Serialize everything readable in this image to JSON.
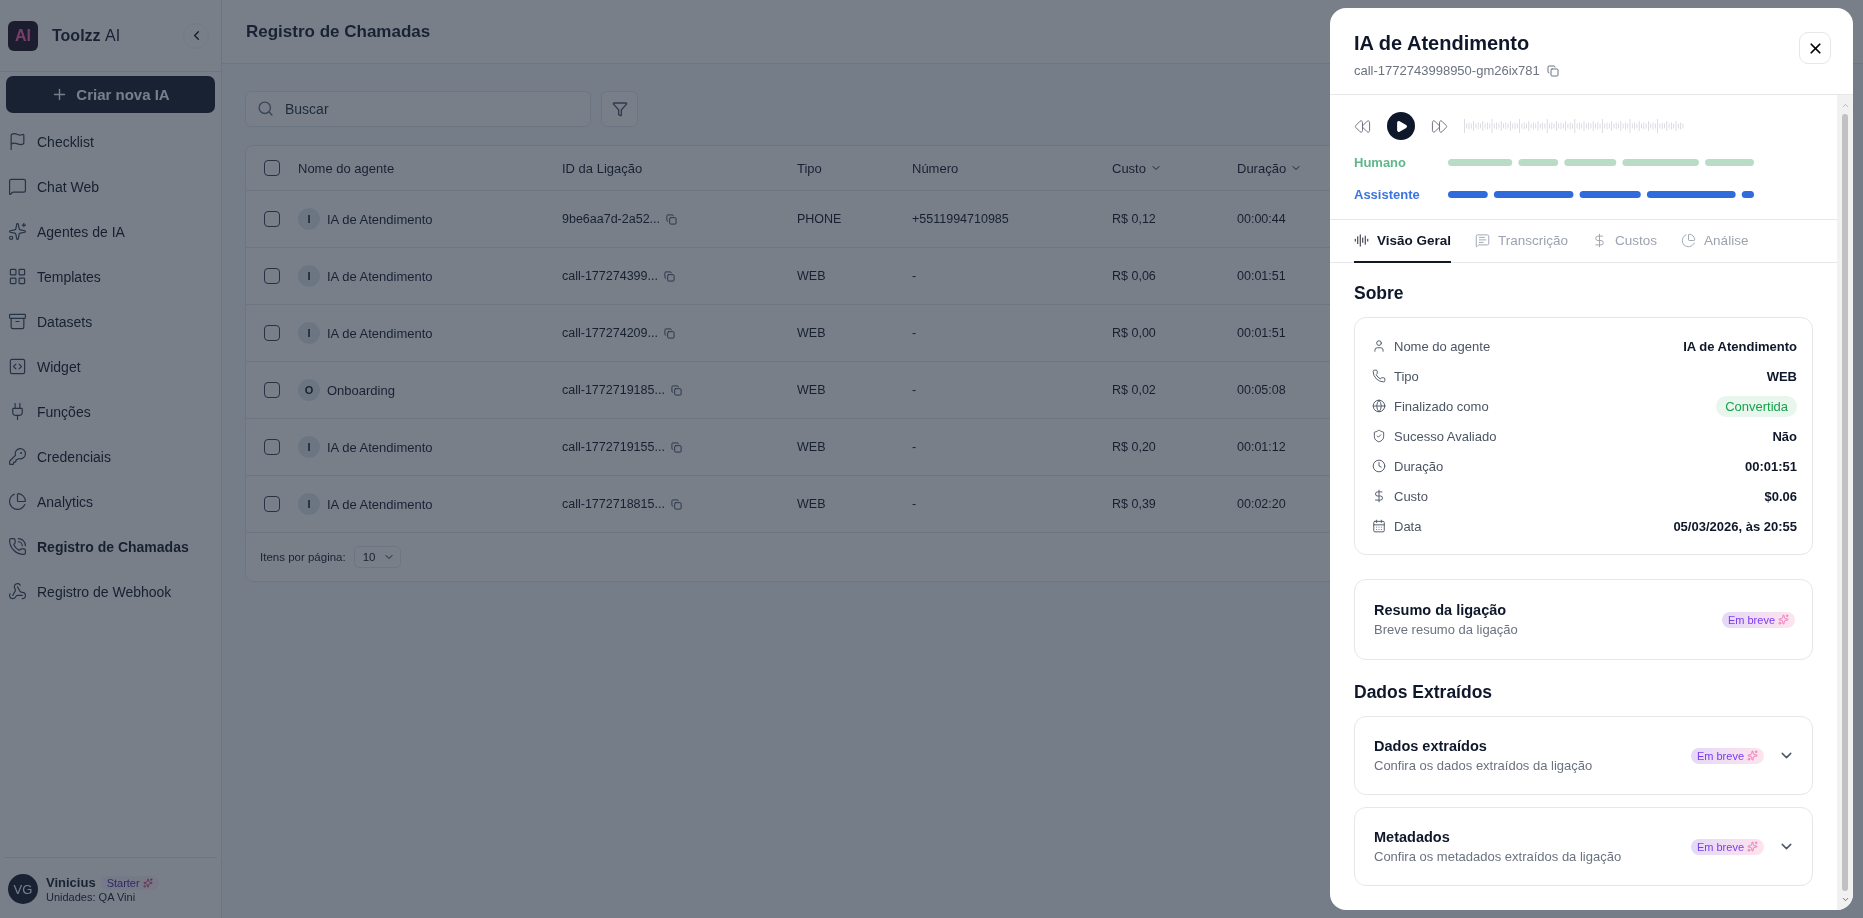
{
  "sidebar": {
    "brand": {
      "logo": "AI",
      "name": "Toolzz",
      "suffix": "AI"
    },
    "create_button": "Criar nova IA",
    "items": [
      {
        "label": "Checklist",
        "selected": false
      },
      {
        "label": "Chat Web",
        "selected": false
      },
      {
        "label": "Agentes de IA",
        "selected": false
      },
      {
        "label": "Templates",
        "selected": false
      },
      {
        "label": "Datasets",
        "selected": false
      },
      {
        "label": "Widget",
        "selected": false
      },
      {
        "label": "Funções",
        "selected": false
      },
      {
        "label": "Credenciais",
        "selected": false
      },
      {
        "label": "Analytics",
        "selected": false
      },
      {
        "label": "Registro de Chamadas",
        "selected": true
      },
      {
        "label": "Registro de Webhook",
        "selected": false
      }
    ],
    "user": {
      "initials": "VG",
      "name": "Vinicius",
      "plan": "Starter",
      "unit": "Unidades: QA Vini"
    }
  },
  "main": {
    "title": "Registro de Chamadas",
    "search": {
      "placeholder": "Buscar"
    },
    "table": {
      "select_all_checked": false,
      "columns": [
        {
          "label": "Nome do agente",
          "sortable": false
        },
        {
          "label": "ID da Ligação",
          "sortable": false
        },
        {
          "label": "Tipo",
          "sortable": false
        },
        {
          "label": "Número",
          "sortable": false
        },
        {
          "label": "Custo",
          "sortable": true
        },
        {
          "label": "Duração",
          "sortable": true
        }
      ],
      "rows": [
        {
          "checked": false,
          "avatar": "I",
          "agent": "IA de Atendimento",
          "call_id": "9be6aa7d-2a52...",
          "type": "PHONE",
          "number": "+5511994710985",
          "cost": "R$ 0,12",
          "duration": "00:00:44"
        },
        {
          "checked": false,
          "avatar": "I",
          "agent": "IA de Atendimento",
          "call_id": "call-177274399...",
          "type": "WEB",
          "number": "-",
          "cost": "R$ 0,06",
          "duration": "00:01:51"
        },
        {
          "checked": false,
          "avatar": "I",
          "agent": "IA de Atendimento",
          "call_id": "call-177274209...",
          "type": "WEB",
          "number": "-",
          "cost": "R$ 0,00",
          "duration": "00:01:51"
        },
        {
          "checked": false,
          "avatar": "O",
          "agent": "Onboarding",
          "call_id": "call-1772719185...",
          "type": "WEB",
          "number": "-",
          "cost": "R$ 0,02",
          "duration": "00:05:08"
        },
        {
          "checked": false,
          "avatar": "I",
          "agent": "IA de Atendimento",
          "call_id": "call-1772719155...",
          "type": "WEB",
          "number": "-",
          "cost": "R$ 0,20",
          "duration": "00:01:12"
        },
        {
          "checked": false,
          "avatar": "I",
          "agent": "IA de Atendimento",
          "call_id": "call-1772718815...",
          "type": "WEB",
          "number": "-",
          "cost": "R$ 0,39",
          "duration": "00:02:20"
        }
      ]
    },
    "pagination": {
      "label": "Itens por página:",
      "value": "10"
    }
  },
  "drawer": {
    "title": "IA de Atendimento",
    "call_id": "call-1772743998950-gm26ix781",
    "tracks": [
      {
        "label": "Humano",
        "kind": "human"
      },
      {
        "label": "Assistente",
        "kind": "assistant"
      }
    ],
    "tabs": [
      {
        "label": "Visão Geral",
        "selected": true
      },
      {
        "label": "Transcrição",
        "selected": false
      },
      {
        "label": "Custos",
        "selected": false
      },
      {
        "label": "Análise",
        "selected": false
      }
    ],
    "about": {
      "title": "Sobre",
      "rows": [
        {
          "label": "Nome do agente",
          "value": "IA de Atendimento",
          "kind": "text"
        },
        {
          "label": "Tipo",
          "value": "WEB",
          "kind": "text"
        },
        {
          "label": "Finalizado como",
          "value": "Convertida",
          "kind": "badge"
        },
        {
          "label": "Sucesso Avaliado",
          "value": "Não",
          "kind": "text"
        },
        {
          "label": "Duração",
          "value": "00:01:51",
          "kind": "text"
        },
        {
          "label": "Custo",
          "value": "$0.06",
          "kind": "text"
        },
        {
          "label": "Data",
          "value": "05/03/2026, às 20:55",
          "kind": "text"
        }
      ]
    },
    "summary": {
      "title": "Resumo da ligação",
      "subtitle": "Breve resumo da ligação",
      "badge": "Em breve"
    },
    "extracted": {
      "title": "Dados Extraídos",
      "cards": [
        {
          "title": "Dados extraídos",
          "subtitle": "Confira os dados extraídos da ligação",
          "badge": "Em breve"
        },
        {
          "title": "Metadados",
          "subtitle": "Confira os metadados extraídos da ligação",
          "badge": "Em breve"
        }
      ]
    }
  }
}
